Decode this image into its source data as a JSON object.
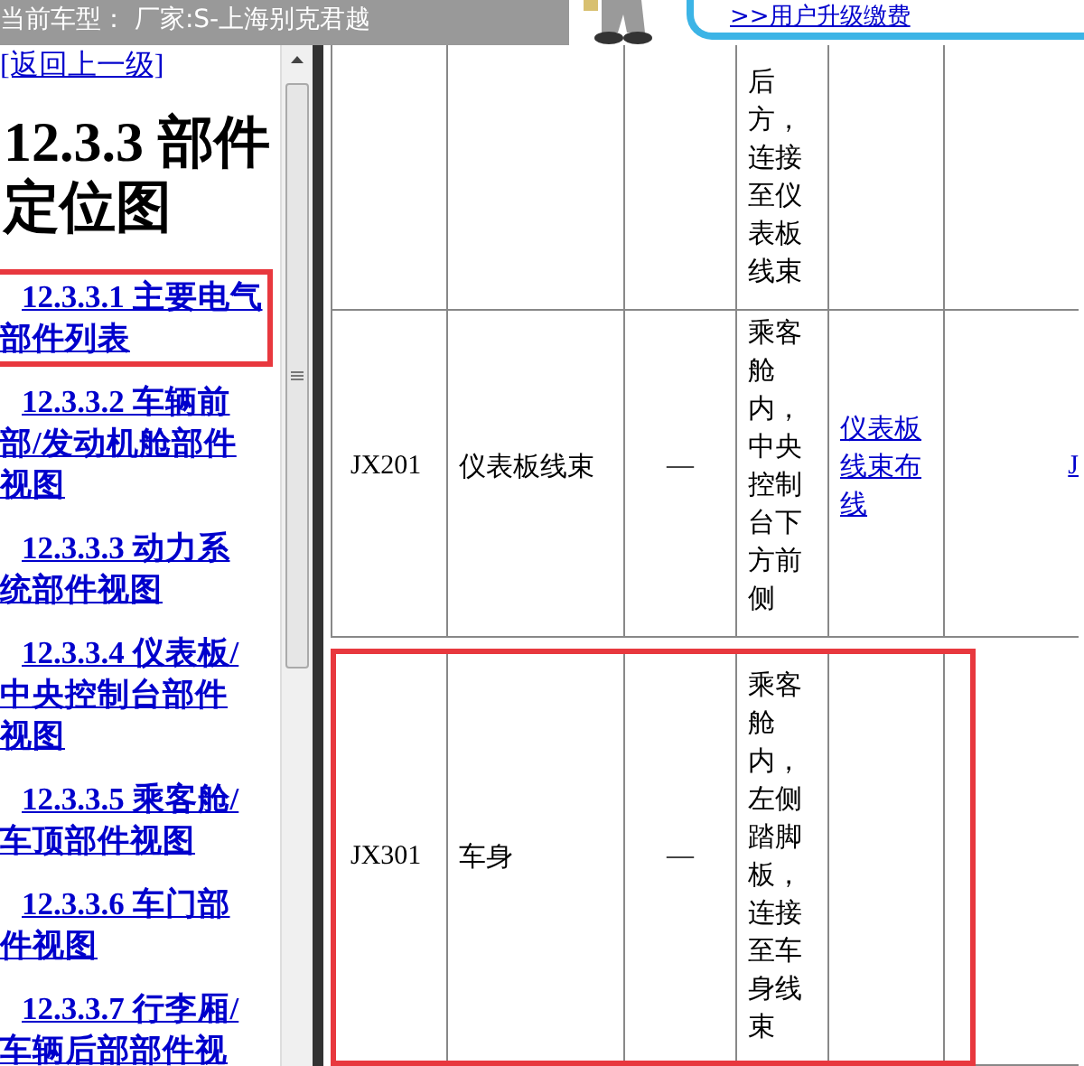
{
  "header": {
    "vehicle_info": "当前车型： 厂家:S-上海别克君越",
    "upgrade_link": ">>用户升级缴费"
  },
  "sidebar": {
    "back_link": "[返回上一级]",
    "heading": "12.3.3 部件定位图",
    "items": [
      {
        "label": "12.3.3.1 主要电气部件列表",
        "highlighted": true
      },
      {
        "label": "12.3.3.2 车辆前部/发动机舱部件视图",
        "highlighted": false
      },
      {
        "label": "12.3.3.3 动力系统部件视图",
        "highlighted": false
      },
      {
        "label": "12.3.3.4 仪表板/中央控制台部件视图",
        "highlighted": false
      },
      {
        "label": "12.3.3.5 乘客舱/车顶部件视图",
        "highlighted": false
      },
      {
        "label": "12.3.3.6 车门部件视图",
        "highlighted": false
      },
      {
        "label": "12.3.3.7 行李厢/车辆后部部件视",
        "highlighted": false
      }
    ]
  },
  "table": {
    "rows": [
      {
        "column_4": "后方，连接至仪表板线束",
        "highlighted": false
      },
      {
        "column_1": "JX201",
        "column_2": "仪表板线束",
        "column_3": "—",
        "column_4": "乘客舱内，中央控制台下方前侧",
        "column_5": "仪表板线束布线",
        "column_6": "J",
        "highlighted": false
      },
      {
        "column_1": "JX301",
        "column_2": "车身",
        "column_3": "—",
        "column_4": "乘客舱内，左侧踏脚板，连接至车身线束",
        "highlighted": true
      }
    ]
  }
}
